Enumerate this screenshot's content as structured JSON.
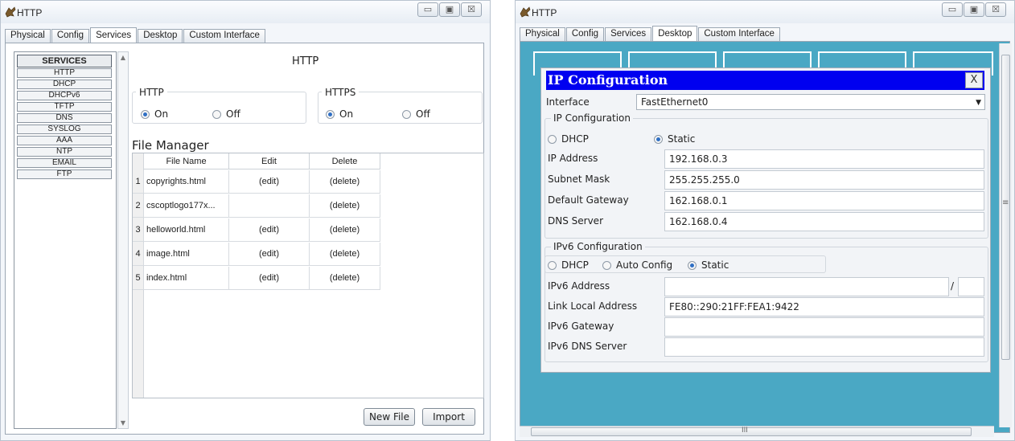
{
  "left_window": {
    "title": "HTTP",
    "controls": {
      "minimize": "▭",
      "maximize": "▣",
      "close": "☒"
    },
    "tabs": [
      {
        "label": "Physical",
        "active": false
      },
      {
        "label": "Config",
        "active": false
      },
      {
        "label": "Services",
        "active": true
      },
      {
        "label": "Desktop",
        "active": false
      },
      {
        "label": "Custom Interface",
        "active": false
      }
    ],
    "services": {
      "header": "SERVICES",
      "items": [
        "HTTP",
        "DHCP",
        "DHCPv6",
        "TFTP",
        "DNS",
        "SYSLOG",
        "AAA",
        "NTP",
        "EMAIL",
        "FTP"
      ],
      "scroll_up": "▲",
      "scroll_down": "▼"
    },
    "http_panel": {
      "heading": "HTTP",
      "http_group": {
        "title": "HTTP",
        "on": "On",
        "off": "Off",
        "selected": "On"
      },
      "https_group": {
        "title": "HTTPS",
        "on": "On",
        "off": "Off",
        "selected": "On"
      }
    },
    "file_manager": {
      "title": "File Manager",
      "columns": [
        "File Name",
        "Edit",
        "Delete"
      ],
      "rows": [
        {
          "num": "1",
          "name": "copyrights.html",
          "edit": "(edit)",
          "delete": "(delete)"
        },
        {
          "num": "2",
          "name": "cscoptlogo177x...",
          "edit": "",
          "delete": "(delete)"
        },
        {
          "num": "3",
          "name": "helloworld.html",
          "edit": "(edit)",
          "delete": "(delete)"
        },
        {
          "num": "4",
          "name": "image.html",
          "edit": "(edit)",
          "delete": "(delete)"
        },
        {
          "num": "5",
          "name": "index.html",
          "edit": "(edit)",
          "delete": "(delete)"
        }
      ],
      "new_file_button": "New File",
      "import_button": "Import"
    }
  },
  "right_window": {
    "title": "HTTP",
    "controls": {
      "minimize": "▭",
      "maximize": "▣",
      "close": "☒"
    },
    "tabs": [
      {
        "label": "Physical",
        "active": false
      },
      {
        "label": "Config",
        "active": false
      },
      {
        "label": "Services",
        "active": false
      },
      {
        "label": "Desktop",
        "active": true
      },
      {
        "label": "Custom Interface",
        "active": false
      }
    ],
    "desktop_bg_color": "#4aa8c4",
    "ip_config": {
      "title": "IP Configuration",
      "close_label": "X",
      "interface_label": "Interface",
      "interface_value": "FastEthernet0",
      "ipv4_section": "IP Configuration",
      "dhcp_label": "DHCP",
      "static_label": "Static",
      "mode": "Static",
      "ip_address_label": "IP Address",
      "ip_address": "192.168.0.3",
      "subnet_mask_label": "Subnet Mask",
      "subnet_mask": "255.255.255.0",
      "gateway_label": "Default Gateway",
      "gateway": "162.168.0.1",
      "dns_label": "DNS Server",
      "dns": "162.168.0.4",
      "ipv6_section": "IPv6 Configuration",
      "ipv6_dhcp_label": "DHCP",
      "ipv6_auto_label": "Auto Config",
      "ipv6_static_label": "Static",
      "ipv6_mode": "Static",
      "ipv6_address_label": "IPv6 Address",
      "ipv6_address": "",
      "prefix_separator": "/",
      "ipv6_prefix": "",
      "link_local_label": "Link Local Address",
      "link_local": "FE80::290:21FF:FEA1:9422",
      "ipv6_gateway_label": "IPv6 Gateway",
      "ipv6_gateway": "",
      "ipv6_dns_label": "IPv6 DNS Server",
      "ipv6_dns": ""
    },
    "hscroll_label": "III",
    "vscroll_mid": "≡"
  }
}
